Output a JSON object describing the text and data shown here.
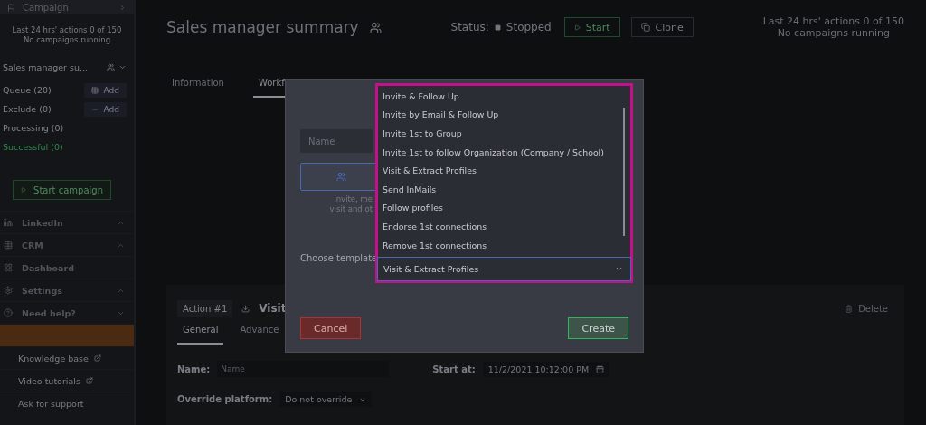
{
  "sidebar": {
    "header": "Campaign",
    "stats": [
      "Last 24 hrs' actions 0 of 150",
      "No campaigns running"
    ],
    "campaign_select": "Sales manager su...",
    "lists": [
      {
        "label": "Queue (20)",
        "kind": "add",
        "button": "Add"
      },
      {
        "label": "Exclude (0)",
        "kind": "add",
        "button": "Add"
      },
      {
        "label": "Processing (0)",
        "kind": "plain"
      },
      {
        "label": "Successful (0)",
        "kind": "success"
      }
    ],
    "start_button": "Start campaign",
    "nav": [
      {
        "label": "LinkedIn",
        "kind": "linkedin",
        "expanded": true
      },
      {
        "label": "CRM",
        "kind": "crm",
        "expanded": true
      },
      {
        "label": "Dashboard",
        "kind": "dashboard"
      },
      {
        "label": "Settings",
        "kind": "settings",
        "expanded": true
      },
      {
        "label": "Need help?",
        "kind": "help",
        "expanded": false
      }
    ],
    "help_items": [
      {
        "kind": "highlight"
      },
      {
        "label": "Knowledge base",
        "kind": "external"
      },
      {
        "label": "Video tutorials",
        "kind": "external"
      },
      {
        "label": "Ask for support",
        "kind": "plain"
      }
    ]
  },
  "header": {
    "title": "Sales manager summary",
    "status_label": "Status:",
    "status": "Stopped",
    "start": "Start",
    "clone": "Clone",
    "stats": [
      "Last 24 hrs' actions 0 of 150",
      "No campaigns running"
    ]
  },
  "tabs": [
    {
      "label": "Information",
      "selected": false
    },
    {
      "label": "Workf",
      "selected": true
    }
  ],
  "action": {
    "badge": "Action #1",
    "title": "Visit",
    "delete": "Delete",
    "tabs": [
      {
        "label": "General",
        "selected": true
      },
      {
        "label": "Advance",
        "selected": false
      }
    ],
    "name_label": "Name:",
    "name_placeholder": "Name",
    "start_label": "Start at:",
    "start_value": "11/2/2021 10:12:00 PM",
    "platform_label": "Override platform:",
    "platform_value": "Do not override"
  },
  "modal": {
    "name_placeholder": "Name",
    "description": [
      "invite, me",
      "visit and ot"
    ],
    "template_label": "Choose template",
    "template_value": "Visit & Extract Profiles",
    "options": [
      "Invite & Follow Up",
      "Invite by Email & Follow Up",
      "Invite 1st to Group",
      "Invite 1st to follow Organization (Company / School)",
      "Visit & Extract Profiles",
      "Send InMails",
      "Follow profiles",
      "Endorse 1st connections",
      "Remove 1st connections"
    ],
    "cancel": "Cancel",
    "create": "Create"
  }
}
